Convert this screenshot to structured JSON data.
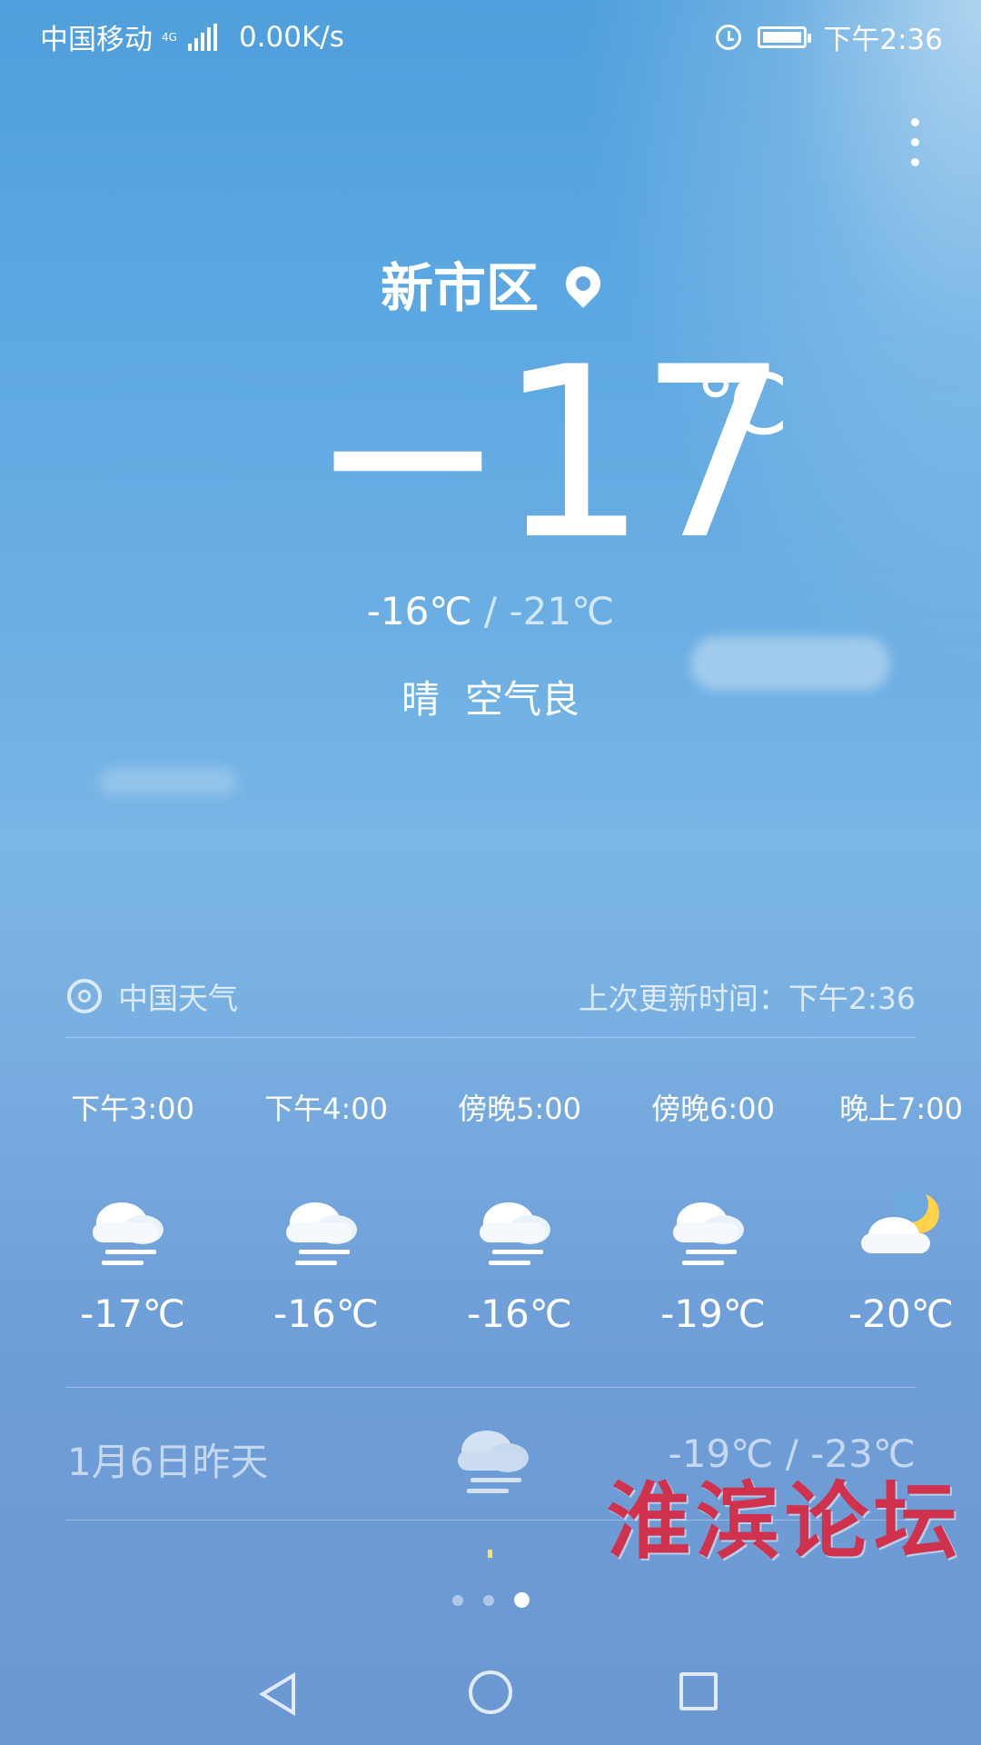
{
  "status_bar": {
    "carrier": "中国移动",
    "network": "4G",
    "speed": "0.00K/s",
    "time": "下午2:36",
    "icons": [
      "signal-icon",
      "alarm-icon",
      "battery-icon"
    ]
  },
  "location": "新市区",
  "current": {
    "temperature": "−17",
    "unit": "℃",
    "high": "-16℃",
    "separator": "/",
    "low": "-21℃",
    "condition": "晴",
    "air": "空气良"
  },
  "source": {
    "name": "中国天气",
    "updated": "上次更新时间：下午2:36"
  },
  "hourly": [
    {
      "time": "下午3:00",
      "icon": "snow-cloud-icon",
      "temp": "-17℃"
    },
    {
      "time": "下午4:00",
      "icon": "snow-cloud-icon",
      "temp": "-16℃"
    },
    {
      "time": "傍晚5:00",
      "icon": "snow-cloud-icon",
      "temp": "-16℃"
    },
    {
      "time": "傍晚6:00",
      "icon": "snow-cloud-icon",
      "temp": "-19℃"
    },
    {
      "time": "晚上7:00",
      "icon": "moon-cloud-icon",
      "temp": "-20℃"
    }
  ],
  "yesterday": {
    "label": "1月6日昨天",
    "icon": "snow-cloud-icon",
    "range": "-19℃ / -23℃"
  },
  "watermark": "淮滨论坛",
  "page_indicator": {
    "count": 3,
    "active": 3
  },
  "colors": {
    "sky_top": "#4f9fdc",
    "sky_bottom": "#6b98d2",
    "watermark": "#d0324e",
    "moon": "#ffd24a"
  }
}
